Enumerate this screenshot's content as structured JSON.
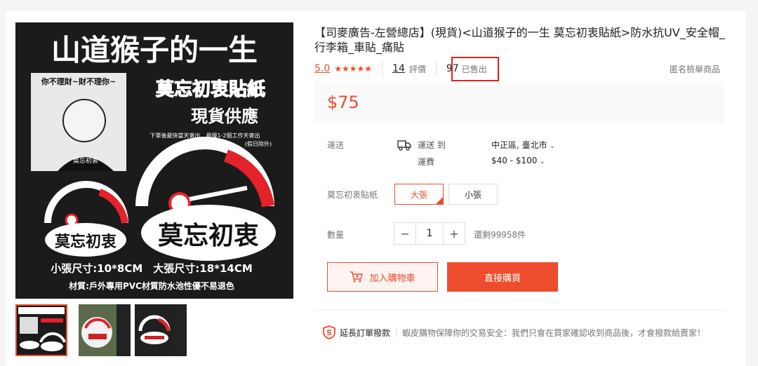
{
  "product": {
    "title": "【司麥廣告-左營總店】(現貨)<山道猴子的一生 莫忘初衷貼紙>防水抗UV_安全帽_行李箱_車貼_痛貼",
    "rating": "5.0",
    "stars": "★★★★★",
    "review_count": "14",
    "review_label": "評價",
    "sold_count": "97",
    "sold_label": "已售出",
    "report_label": "匿名檢舉商品",
    "price": "$75"
  },
  "image": {
    "headline": "山道猴子的一生",
    "bubble": "你不理財~財不理你~",
    "red_title": "莫忘初衷貼紙",
    "subtitle": "現貨供應",
    "note1": "下單後最快當天寄出．最慢1-2個工作天寄出",
    "note2": "(假日除外)",
    "shirt_text": "莫忘初衷",
    "logo_small": "莫忘初衷",
    "logo_big": "莫忘初衷",
    "size_line": "小張尺寸:10*8CM　大張尺寸:18*14CM",
    "material_line": "材質:戶外專用PVC材質防水池性優不易退色"
  },
  "shipping": {
    "label": "運送",
    "to_label": "運送 到",
    "fee_label": "運費",
    "location": "中正區, 臺北市",
    "fee": "$40 - $100"
  },
  "variants": {
    "label": "莫忘初衷貼紙",
    "options": [
      "大張",
      "小張"
    ]
  },
  "quantity": {
    "label": "數量",
    "value": "1",
    "minus": "−",
    "plus": "+",
    "stock": "還剩99958件"
  },
  "actions": {
    "add_to_cart": "加入購物車",
    "buy_now": "直接購買"
  },
  "guarantee": {
    "title": "延長訂單撥款",
    "text": "蝦皮購物保障你的交易安全：我們只會在買家確認收到商品後，才會撥款給賣家！"
  },
  "colors": {
    "accent": "#ee4d2d",
    "highlight_box": "#e02020"
  }
}
